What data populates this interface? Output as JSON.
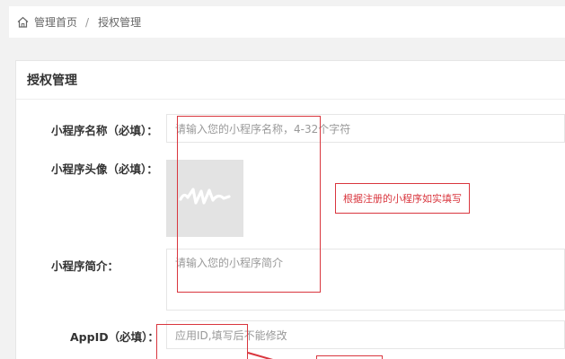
{
  "breadcrumb": {
    "home": "管理首页",
    "separator": "/",
    "current": "授权管理"
  },
  "panel": {
    "title": "授权管理"
  },
  "form": {
    "name_label": "小程序名称（必填）：",
    "name_placeholder": "请输入您的小程序名称，4-32个字符",
    "avatar_label": "小程序头像（必填）：",
    "intro_label": "小程序简介：",
    "intro_placeholder": "请输入您的小程序简介",
    "appid_label": "AppID（必填）：",
    "appid_placeholder": "应用ID,填写后不能修改"
  },
  "annotation": {
    "note": "根据注册的小程序如实填写"
  },
  "colors": {
    "annotation_red": "#d9363e",
    "avatar_bg": "#e3e3e3"
  },
  "icons": {
    "home": "home-icon",
    "avatar_placeholder": "upload-placeholder-icon"
  }
}
